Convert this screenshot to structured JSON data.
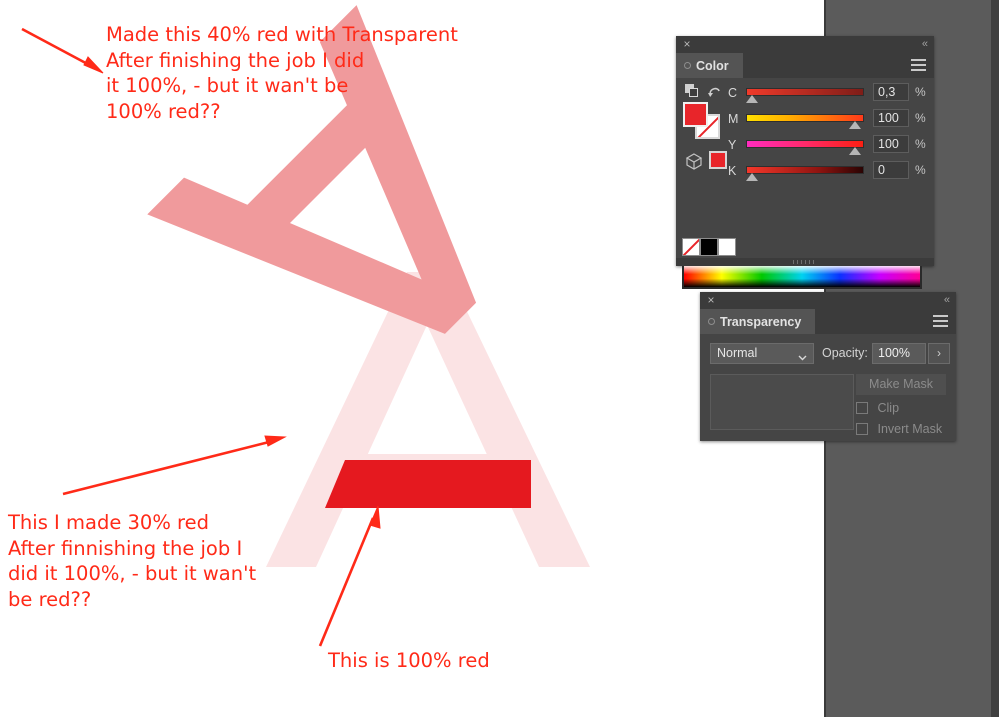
{
  "canvas": {
    "background": "#ffffff",
    "app_background": "#5b5b5b"
  },
  "annotations": {
    "top_note": "Made this 40% red with Transparent\nAfter finishing the job I did\nit 100%, - but it wan't be\n100% red??",
    "bottom_note": "This I made 30% red\nAfter finnishing the job I\ndid it 100%, - but it wan't\nbe red??",
    "red_shape_note": "This is 100% red",
    "color": "#ff2a18"
  },
  "artwork": {
    "rotated_a": {
      "name": "rotated-a-shape",
      "fill": "#f09a9c",
      "opacity_label": "40% red"
    },
    "big_a": {
      "name": "big-a-shape",
      "fill": "#fbe3e4",
      "opacity_label": "30% red"
    },
    "trapezoid": {
      "name": "red-trapezoid-shape",
      "fill": "#e5191f",
      "opacity_label": "100% red"
    }
  },
  "color_panel": {
    "title": "Color",
    "close_icon": "×",
    "collapse_icon": "«",
    "menu_icon": "hamburger-menu",
    "fill_swatch": "#e8252a",
    "stroke_swatch": "#ffffff",
    "small_swatch": "#e8252a",
    "sliders": [
      {
        "label": "C",
        "value": "0,3",
        "unit": "%",
        "thumb_pct": 1,
        "gradient": "linear-gradient(to right,#f03a2a 0%,#7e1d18 100%)"
      },
      {
        "label": "M",
        "value": "100",
        "unit": "%",
        "thumb_pct": 98,
        "gradient": "linear-gradient(to right,#ffe000 0%,#ffb000 35%,#ff3a1a 100%)"
      },
      {
        "label": "Y",
        "value": "100",
        "unit": "%",
        "thumb_pct": 98,
        "gradient": "linear-gradient(to right,#ff2bbf 0%,#ff2a6a 50%,#fb1f12 100%)"
      },
      {
        "label": "K",
        "value": "0",
        "unit": "%",
        "thumb_pct": 1,
        "gradient": "linear-gradient(to right,#f5372a 0%,#8e1410 62%,#2a0403 100%)"
      }
    ],
    "none_swatch": "none-swatch",
    "black_swatch": "#000000",
    "white_swatch": "#ffffff",
    "spectrum": "color-spectrum-ramp"
  },
  "transparency_panel": {
    "title": "Transparency",
    "close_icon": "×",
    "collapse_icon": "«",
    "menu_icon": "hamburger-menu",
    "blend_mode": "Normal",
    "opacity_label": "Opacity:",
    "opacity_value": "100%",
    "opacity_arrow": "›",
    "make_mask_label": "Make Mask",
    "clip_label": "Clip",
    "invert_mask_label": "Invert Mask",
    "clip_checked": false,
    "invert_checked": false
  }
}
